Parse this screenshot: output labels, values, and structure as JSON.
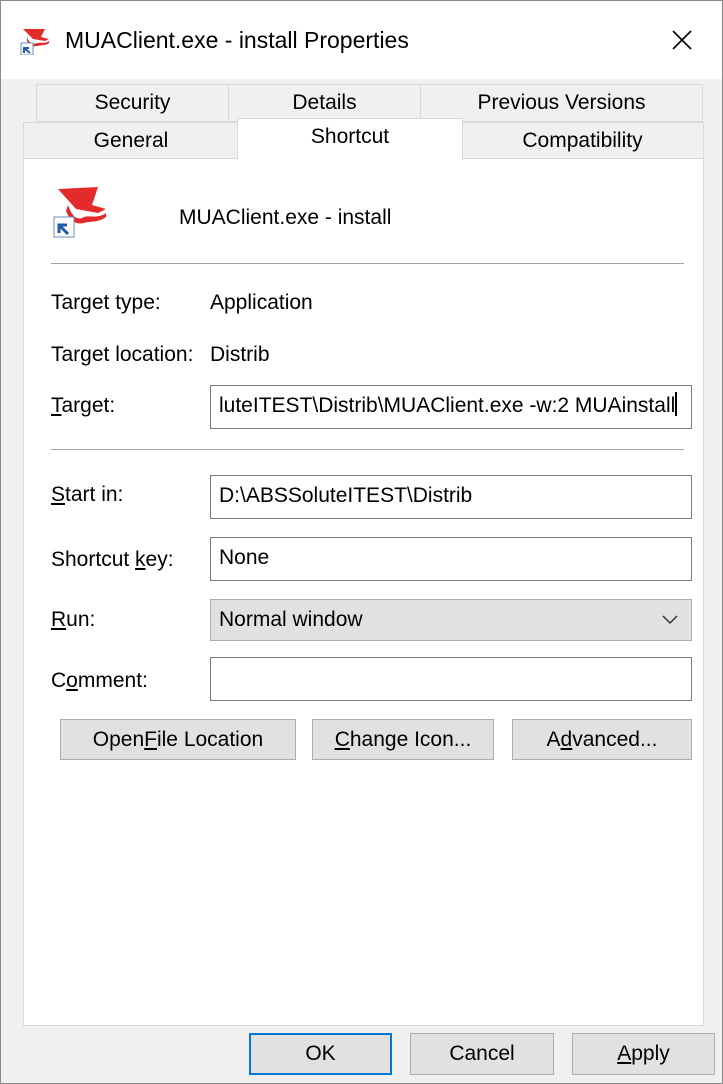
{
  "window": {
    "title": "MUAClient.exe - install Properties",
    "close_glyph": "✕"
  },
  "tabs": {
    "row1": [
      {
        "label": "Security"
      },
      {
        "label": "Details"
      },
      {
        "label": "Previous Versions"
      }
    ],
    "row2": [
      {
        "label": "General"
      },
      {
        "label": "Shortcut",
        "active": true
      },
      {
        "label": "Compatibility"
      }
    ]
  },
  "shortcut": {
    "name": "MUAClient.exe - install",
    "target_type_label": "Target type:",
    "target_type_value": "Application",
    "target_location_label": "Target location:",
    "target_location_value": "Distrib",
    "target_label_pre": "",
    "target_label_ul": "T",
    "target_label_post": "arget:",
    "target_value": "luteITEST\\Distrib\\MUAClient.exe -w:2 MUAinstall",
    "start_in_label_pre": "",
    "start_in_label_ul": "S",
    "start_in_label_post": "tart in:",
    "start_in_value": "D:\\ABSSoluteITEST\\Distrib",
    "shortcut_key_label_pre": "Shortcut ",
    "shortcut_key_label_ul": "k",
    "shortcut_key_label_post": "ey:",
    "shortcut_key_value": "None",
    "run_label_pre": "",
    "run_label_ul": "R",
    "run_label_post": "un:",
    "run_value": "Normal window",
    "comment_label_pre": "C",
    "comment_label_ul": "o",
    "comment_label_post": "mment:",
    "comment_value": ""
  },
  "panel_buttons": {
    "open_file_location": {
      "pre": "Open ",
      "ul": "F",
      "post": "ile Location"
    },
    "change_icon": {
      "pre": "",
      "ul": "C",
      "post": "hange Icon..."
    },
    "advanced": {
      "pre": "A",
      "ul": "d",
      "post": "vanced..."
    }
  },
  "footer": {
    "ok": "OK",
    "cancel": "Cancel",
    "apply_ul": "A",
    "apply_post": "pply"
  },
  "icons": {
    "app_icon": "red-hat-icon",
    "shortcut_overlay": "shortcut-arrow-icon",
    "dropdown": "chevron-down-icon",
    "close": "close-icon"
  },
  "colors": {
    "accent": "#0078d7",
    "app_red": "#e32b2b"
  }
}
